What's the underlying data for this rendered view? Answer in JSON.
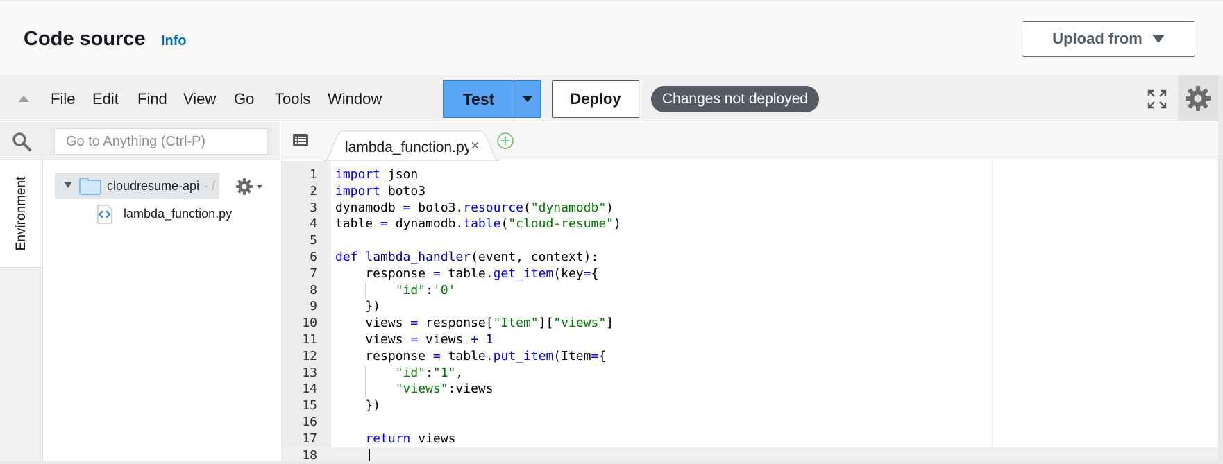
{
  "header": {
    "title": "Code source",
    "info_link": "Info",
    "upload_button": "Upload from"
  },
  "menu": {
    "items": [
      "File",
      "Edit",
      "Find",
      "View",
      "Go",
      "Tools",
      "Window"
    ]
  },
  "toolbar": {
    "test_label": "Test",
    "deploy_label": "Deploy",
    "status": "Changes not deployed"
  },
  "sidebar": {
    "search_placeholder": "Go to Anything (Ctrl-P)",
    "environment_tab": "Environment",
    "folder_name": "cloudresume-api",
    "folder_suffix": "- /",
    "file_name": "lambda_function.py"
  },
  "editor": {
    "tab_label": "lambda_function.py",
    "tab_close": "×",
    "lines": [
      "import json",
      "import boto3",
      "dynamodb = boto3.resource(\"dynamodb\")",
      "table = dynamodb.table(\"cloud-resume\")",
      "",
      "def lambda_handler(event, context):",
      "    response = table.get_item(key={",
      "        \"id\":'0'",
      "    })",
      "    views = response[\"Item\"][\"views\"]",
      "    views = views + 1",
      "    response = table.put_item(Item={",
      "        \"id\":\"1\",",
      "        \"views\":views",
      "    })",
      "",
      "    return views",
      ""
    ]
  },
  "colors": {
    "info_link": "#0073bb",
    "test_button": "#5aa5f4",
    "status_pill": "#545b64",
    "keyword": "#0000ff",
    "string": "#007700"
  },
  "icons": [
    "collapse-up-icon",
    "fullscreen-icon",
    "gear-icon",
    "search-icon",
    "folder-icon",
    "python-file-icon",
    "tab-menu-icon",
    "add-tab-icon"
  ]
}
